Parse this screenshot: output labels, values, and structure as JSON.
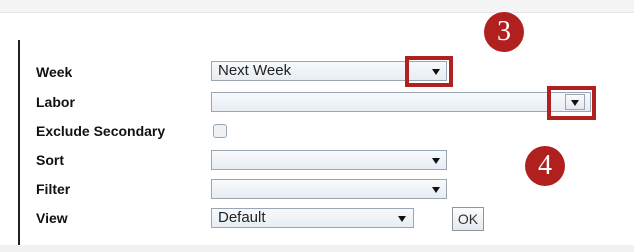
{
  "form": {
    "week": {
      "label": "Week",
      "value": "Next Week"
    },
    "labor": {
      "label": "Labor",
      "value": ""
    },
    "exclude_secondary": {
      "label": "Exclude Secondary",
      "checked": false
    },
    "sort": {
      "label": "Sort",
      "value": ""
    },
    "filter": {
      "label": "Filter",
      "value": ""
    },
    "view": {
      "label": "View",
      "value": "Default"
    },
    "ok_label": "OK"
  },
  "annotations": {
    "badge3": "3",
    "badge4": "4",
    "color": "#b0201e"
  }
}
